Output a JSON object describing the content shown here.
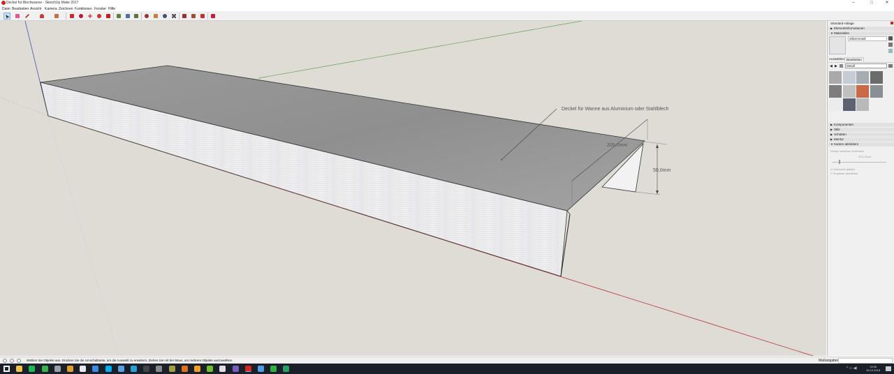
{
  "window": {
    "title": "Deckel für Blechwanne - SketchUp Make 2017",
    "min": "–",
    "max": "□",
    "close": "✕"
  },
  "menu": [
    "Datei",
    "Bearbeiten",
    "Ansicht",
    "Kamera",
    "Zeichnen",
    "Funktionen",
    "Fenster",
    "Hilfe"
  ],
  "toolbar": {
    "icons": [
      {
        "name": "select-tool-icon",
        "color": "#e8e8e8"
      },
      {
        "name": "eraser-tool-icon",
        "color": "#e05a8a"
      },
      {
        "name": "line-tool-icon",
        "color": "#b03030"
      },
      {
        "name": "arc-tool-icon",
        "color": "#c04040"
      },
      {
        "name": "shape-tool-icon",
        "color": "#c07040"
      },
      {
        "name": "push-pull-tool-icon",
        "color": "#c03030"
      },
      {
        "name": "offset-tool-icon",
        "color": "#b02030"
      },
      {
        "name": "move-tool-icon",
        "color": "#d02020"
      },
      {
        "name": "rotate-tool-icon",
        "color": "#d03030"
      },
      {
        "name": "scale-tool-icon",
        "color": "#c02020"
      },
      {
        "name": "tape-measure-tool-icon",
        "color": "#608040"
      },
      {
        "name": "text-tool-icon",
        "color": "#5070a0"
      },
      {
        "name": "paint-bucket-tool-icon",
        "color": "#607040"
      },
      {
        "name": "orbit-tool-icon",
        "color": "#a03030"
      },
      {
        "name": "pan-tool-icon",
        "color": "#c08040"
      },
      {
        "name": "zoom-tool-icon",
        "color": "#405070"
      },
      {
        "name": "zoom-extents-tool-icon",
        "color": "#504050"
      },
      {
        "name": "warehouse-icon",
        "color": "#a03030"
      },
      {
        "name": "extension-warehouse-icon",
        "color": "#a05030"
      },
      {
        "name": "send-to-layout-icon",
        "color": "#c03030"
      },
      {
        "name": "extension-manager-icon",
        "color": "#c02040"
      }
    ]
  },
  "model": {
    "annotation": "Deckel für Wanne aus Aluminium oder Stahlblech",
    "dim_width": "200,0mm",
    "dim_height": "50,0mm"
  },
  "tray": {
    "title": "Standard-Ablage",
    "sections": {
      "entity_info": "Elementinformationen",
      "materials": "Materialien"
    },
    "material_name": "Silbermetall",
    "tabs": [
      "Auswählen",
      "Bearbeiten"
    ],
    "category": "Metall",
    "swatches": [
      "#a9a9a9",
      "#c5ccd6",
      "#a5acb2",
      "#6b6b6b",
      "#7d7d7d",
      "#c0c0c0",
      "#c86a48",
      "#8a8f95",
      "#ececec",
      "#5c6270",
      "#b9b9b9"
    ],
    "bottom_sections": [
      "Komponenten",
      "Stile",
      "Schatten",
      "Mentor",
      "Kanten abmildern"
    ],
    "soften": {
      "angle_label": "Winkel zwischen Normalen",
      "angle_value": "20,0 Grad",
      "smooth_normals": "Normalen glätten",
      "soften_coplanar": "Koplanar abmildern"
    }
  },
  "status": {
    "message": "Wählen Sie Objekte aus. Drücken Sie die Umschalttaste, um die Auswahl zu erweitern. Ziehen Sie mit der Maus, um mehrere Objekte auszuwählen.",
    "measurements_label": "Maßangaben"
  },
  "taskbar": {
    "apps": [
      {
        "name": "start-icon",
        "color": "#ffffff"
      },
      {
        "name": "file-explorer-icon",
        "color": "#f2c14e"
      },
      {
        "name": "spotify-icon",
        "color": "#1db954"
      },
      {
        "name": "app-green-icon",
        "color": "#37b24d"
      },
      {
        "name": "app-gray-icon",
        "color": "#9aa0a6"
      },
      {
        "name": "chrome-icon",
        "color": "#e0a030"
      },
      {
        "name": "store-icon",
        "color": "#e8e8e8"
      },
      {
        "name": "app-blue-icon",
        "color": "#3d8be0"
      },
      {
        "name": "skype-icon",
        "color": "#00aff0"
      },
      {
        "name": "app-lightblue-icon",
        "color": "#5aa0e0"
      },
      {
        "name": "app-cyan-icon",
        "color": "#2aa0d0"
      },
      {
        "name": "app-dark-icon",
        "color": "#444444"
      },
      {
        "name": "app-gray2-icon",
        "color": "#8a8a8a"
      },
      {
        "name": "app-olive-icon",
        "color": "#a0a040"
      },
      {
        "name": "app-orange-icon",
        "color": "#e07020"
      },
      {
        "name": "app-orange2-icon",
        "color": "#f0a020"
      },
      {
        "name": "app-lime-icon",
        "color": "#70c030"
      },
      {
        "name": "app-white-icon",
        "color": "#e0e0e0"
      },
      {
        "name": "app-purple-icon",
        "color": "#7a5cc0"
      },
      {
        "name": "sketchup-icon",
        "color": "#d3261f"
      },
      {
        "name": "app-check-icon",
        "color": "#4aa0e0"
      },
      {
        "name": "app-green2-icon",
        "color": "#30b040"
      },
      {
        "name": "edge-icon",
        "color": "#2aa060"
      }
    ],
    "time": "19:56",
    "date": "18.10.2018"
  }
}
